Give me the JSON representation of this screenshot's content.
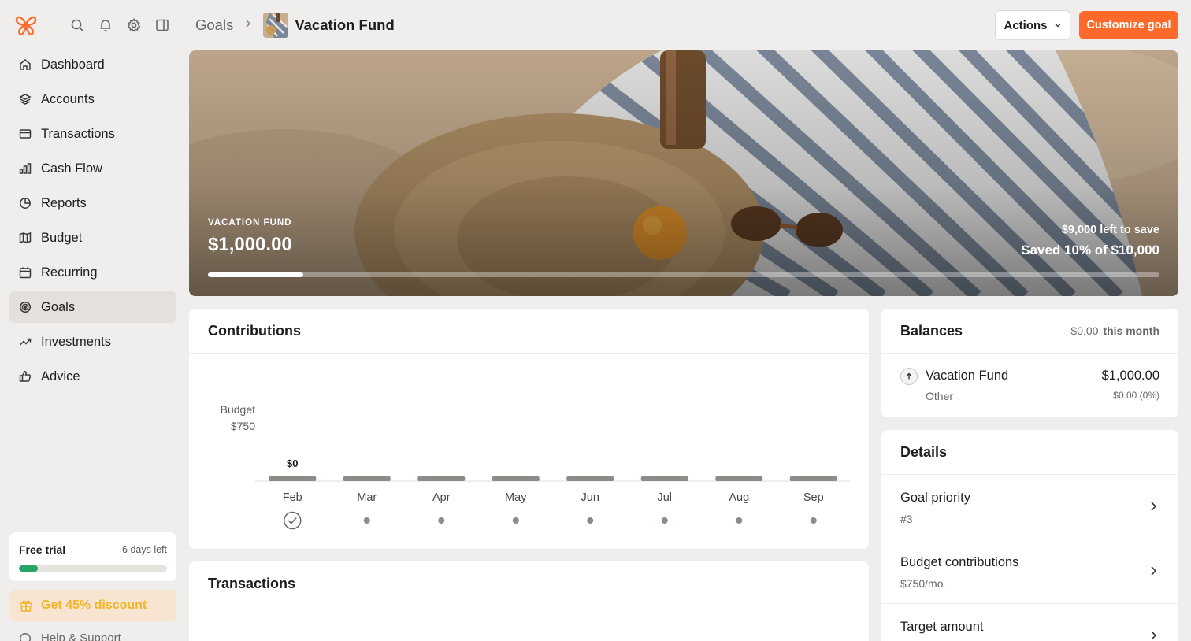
{
  "sidebar": {
    "icons": [
      "logo-butterfly-icon",
      "search-icon",
      "bell-icon",
      "gear-icon",
      "sidebar-toggle-icon"
    ],
    "items": [
      {
        "label": "Dashboard",
        "icon": "home-icon",
        "active": false
      },
      {
        "label": "Accounts",
        "icon": "layers-icon",
        "active": false
      },
      {
        "label": "Transactions",
        "icon": "credit-card-icon",
        "active": false
      },
      {
        "label": "Cash Flow",
        "icon": "bar-chart-icon",
        "active": false
      },
      {
        "label": "Reports",
        "icon": "pie-chart-icon",
        "active": false
      },
      {
        "label": "Budget",
        "icon": "map-icon",
        "active": false
      },
      {
        "label": "Recurring",
        "icon": "calendar-icon",
        "active": false
      },
      {
        "label": "Goals",
        "icon": "target-icon",
        "active": true
      },
      {
        "label": "Investments",
        "icon": "trending-up-icon",
        "active": false
      },
      {
        "label": "Advice",
        "icon": "thumbs-up-icon",
        "active": false
      }
    ],
    "trial": {
      "title": "Free trial",
      "days_left": "6 days left",
      "progress": 0.13,
      "color": "#28a466"
    },
    "discount": {
      "label": "Get 45% discount",
      "color": "#f0b52a"
    },
    "help": {
      "label": "Help & Support"
    }
  },
  "header": {
    "breadcrumb_root": "Goals",
    "breadcrumb_current": "Vacation Fund",
    "actions_label": "Actions",
    "customize_label": "Customize goal",
    "accent": "#ff6a2a"
  },
  "hero": {
    "label": "VACATION FUND",
    "amount": "$1,000.00",
    "left_to_save": "$9,000 left to save",
    "saved_text": "Saved 10% of $10,000",
    "progress": 0.1
  },
  "contributions": {
    "title": "Contributions",
    "budget_label": "Budget",
    "budget_value": "$750",
    "bar_label": "$0",
    "months": [
      "Feb",
      "Mar",
      "Apr",
      "May",
      "Jun",
      "Jul",
      "Aug",
      "Sep"
    ],
    "status": [
      "done",
      "pending",
      "pending",
      "pending",
      "pending",
      "pending",
      "pending",
      "pending"
    ]
  },
  "chart_data": {
    "type": "bar",
    "categories": [
      "Feb",
      "Mar",
      "Apr",
      "May",
      "Jun",
      "Jul",
      "Aug",
      "Sep"
    ],
    "values": [
      0,
      0,
      0,
      0,
      0,
      0,
      0,
      0
    ],
    "budget_line": 750,
    "ylim": [
      0,
      1000
    ],
    "grid": false
  },
  "transactions": {
    "title": "Transactions"
  },
  "balances": {
    "title": "Balances",
    "month_value": "$0.00",
    "month_label": "this month",
    "row": {
      "name": "Vacation Fund",
      "type": "Other",
      "amount": "$1,000.00",
      "change": "$0.00 (0%)"
    }
  },
  "details": {
    "title": "Details",
    "rows": [
      {
        "label": "Goal priority",
        "value": "#3"
      },
      {
        "label": "Budget contributions",
        "value": "$750/mo"
      },
      {
        "label": "Target amount",
        "value": ""
      }
    ]
  }
}
